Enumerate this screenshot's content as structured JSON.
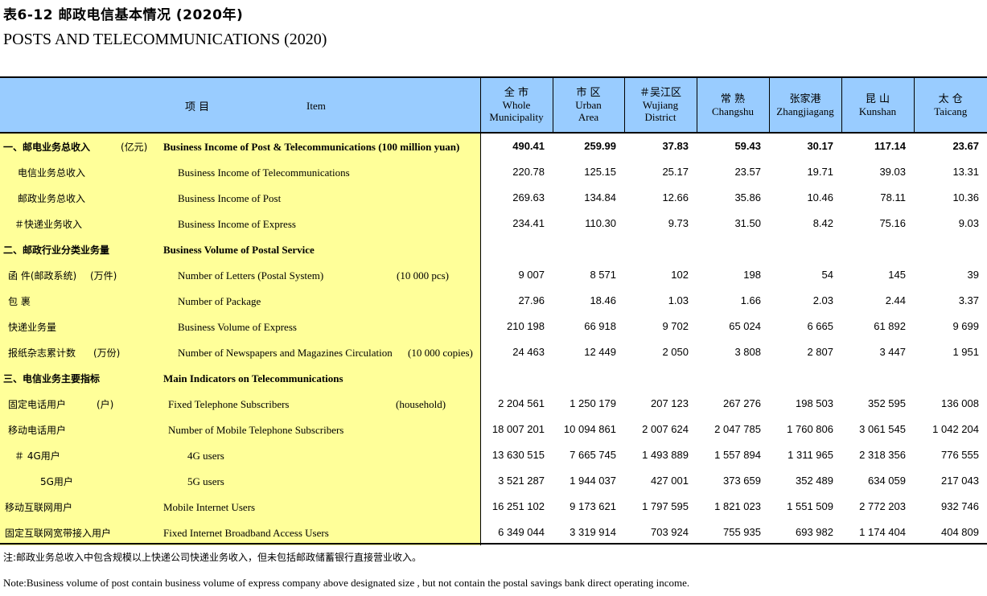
{
  "title_cn": "表6-12 邮政电信基本情况 (2020年)",
  "title_en": "POSTS AND TELECOMMUNICATIONS (2020)",
  "header": {
    "item_cn": "项 目",
    "item_en": "Item",
    "columns": [
      {
        "cn": "全 市",
        "en1": "Whole",
        "en2": "Municipality"
      },
      {
        "cn": "市 区",
        "en1": "Urban",
        "en2": "Area"
      },
      {
        "cn": "＃吴江区",
        "en1": "Wujiang",
        "en2": "District"
      },
      {
        "cn": "常 熟",
        "en1": "Changshu",
        "en2": ""
      },
      {
        "cn": "张家港",
        "en1": "Zhangjiagang",
        "en2": ""
      },
      {
        "cn": "昆 山",
        "en1": "Kunshan",
        "en2": ""
      },
      {
        "cn": "太 仓",
        "en1": "Taicang",
        "en2": ""
      }
    ]
  },
  "rows": [
    {
      "cn": "一、邮电业务总收入",
      "unit_cn": "(亿元)",
      "en": "Business Income of Post & Telecommunications (100 million yuan)",
      "unit_en": "",
      "bold": true,
      "values": [
        "490.41",
        "259.99",
        "37.83",
        "59.43",
        "30.17",
        "117.14",
        "23.67"
      ]
    },
    {
      "cn": "电信业务总收入",
      "unit_cn": "",
      "en": "Business Income of  Telecommunications",
      "unit_en": "",
      "bold": false,
      "values": [
        "220.78",
        "125.15",
        "25.17",
        "23.57",
        "19.71",
        "39.03",
        "13.31"
      ]
    },
    {
      "cn": "邮政业务总收入",
      "unit_cn": "",
      "en": "Business Income of Post",
      "unit_en": "",
      "bold": false,
      "values": [
        "269.63",
        "134.84",
        "12.66",
        "35.86",
        "10.46",
        "78.11",
        "10.36"
      ]
    },
    {
      "cn": "＃快递业务收入",
      "unit_cn": "",
      "en": "Business Income of Express",
      "unit_en": "",
      "bold": false,
      "values": [
        "234.41",
        "110.30",
        "9.73",
        "31.50",
        "8.42",
        "75.16",
        "9.03"
      ]
    },
    {
      "cn": "二、邮政行业分类业务量",
      "unit_cn": "",
      "en": "Business Volume of  Postal Service",
      "unit_en": "",
      "bold": true,
      "values": [
        "",
        "",
        "",
        "",
        "",
        "",
        ""
      ]
    },
    {
      "cn": "函 件(邮政系统)",
      "unit_cn": "(万件)",
      "en": "Number of Letters (Postal System)",
      "unit_en": "(10 000 pcs)",
      "bold": false,
      "values": [
        "9 007",
        "8 571",
        "102",
        "198",
        "54",
        "145",
        "39"
      ]
    },
    {
      "cn": "包 裹",
      "unit_cn": "",
      "en": "Number of Package",
      "unit_en": "",
      "bold": false,
      "values": [
        "27.96",
        "18.46",
        "1.03",
        "1.66",
        "2.03",
        "2.44",
        "3.37"
      ]
    },
    {
      "cn": "快递业务量",
      "unit_cn": "",
      "en": "Business Volume of  Express",
      "unit_en": "",
      "bold": false,
      "values": [
        "210 198",
        "66 918",
        "9 702",
        "65 024",
        "6 665",
        "61 892",
        "9 699"
      ]
    },
    {
      "cn": "报纸杂志累计数",
      "unit_cn": "(万份)",
      "en": "Number of Newspapers and Magazines Circulation",
      "unit_en": "(10 000 copies)",
      "bold": false,
      "values": [
        "24 463",
        "12 449",
        "2 050",
        "3 808",
        "2 807",
        "3 447",
        "1 951"
      ]
    },
    {
      "cn": "三、电信业务主要指标",
      "unit_cn": "",
      "en": "Main Indicators on  Telecommunications",
      "unit_en": "",
      "bold": true,
      "values": [
        "",
        "",
        "",
        "",
        "",
        "",
        ""
      ]
    },
    {
      "cn": "固定电话用户",
      "unit_cn": "(户)",
      "en": "Fixed Telephone Subscribers",
      "unit_en": "(household)",
      "bold": false,
      "values": [
        "2 204 561",
        "1 250 179",
        "207 123",
        "267 276",
        "198 503",
        "352 595",
        "136 008"
      ]
    },
    {
      "cn": "移动电话用户",
      "unit_cn": "",
      "en": "Number of Mobile Telephone Subscribers",
      "unit_en": "",
      "bold": false,
      "values": [
        "18 007 201",
        "10 094 861",
        "2 007 624",
        "2 047 785",
        "1 760 806",
        "3 061 545",
        "1 042 204"
      ]
    },
    {
      "cn": "＃ 4G用户",
      "unit_cn": "",
      "en": "4G  users",
      "unit_en": "",
      "bold": false,
      "values": [
        "13 630 515",
        "7 665 745",
        "1 493 889",
        "1 557 894",
        "1 311 965",
        "2 318 356",
        "776 555"
      ]
    },
    {
      "cn": "5G用户",
      "unit_cn": "",
      "en": "5G  users",
      "unit_en": "",
      "bold": false,
      "values": [
        "3 521 287",
        "1 944 037",
        "427 001",
        "373 659",
        "352 489",
        "634 059",
        "217 043"
      ]
    },
    {
      "cn": "移动互联网用户",
      "unit_cn": "",
      "en": "Mobile Internet Users",
      "unit_en": "",
      "bold": false,
      "values": [
        "16 251 102",
        "9 173 621",
        "1 797 595",
        "1 821 023",
        "1 551 509",
        "2 772 203",
        "932 746"
      ]
    },
    {
      "cn": "固定互联网宽带接入用户",
      "unit_cn": "",
      "en": "Fixed Internet Broadband Access Users",
      "unit_en": "",
      "bold": false,
      "values": [
        "6 349 044",
        "3 319 914",
        "703 924",
        "755 935",
        "693 982",
        "1 174 404",
        "404 809"
      ]
    }
  ],
  "note_cn": "注:邮政业务总收入中包含规模以上快递公司快递业务收入，但未包括邮政储蓄银行直接营业收入。",
  "note_en": "Note:Business volume of post contain  business volume of express company above designated size , but not contain the postal savings bank direct operating income."
}
